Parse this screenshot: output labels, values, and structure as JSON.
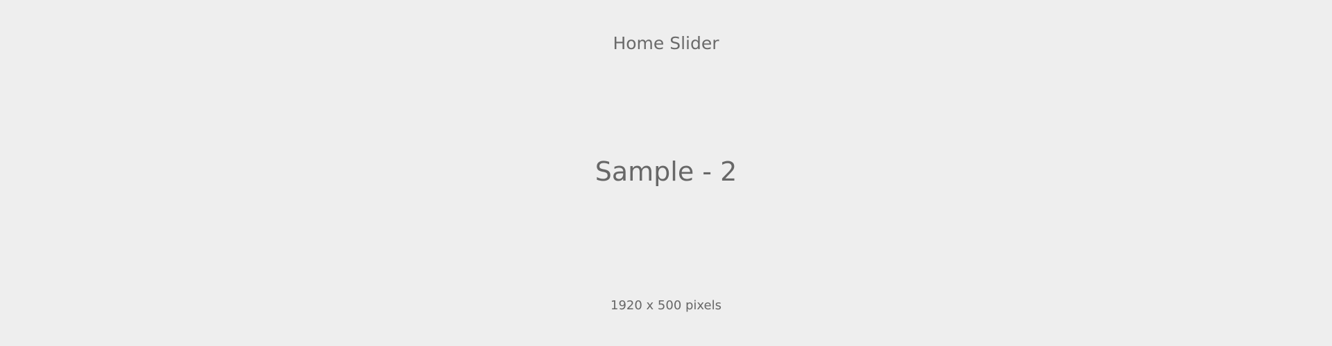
{
  "slider": {
    "header": "Home Slider",
    "title": "Sample - 2",
    "caption": "1920 x 500 pixels"
  },
  "colors": {
    "background": "#eeeeee",
    "text": "#666666"
  }
}
